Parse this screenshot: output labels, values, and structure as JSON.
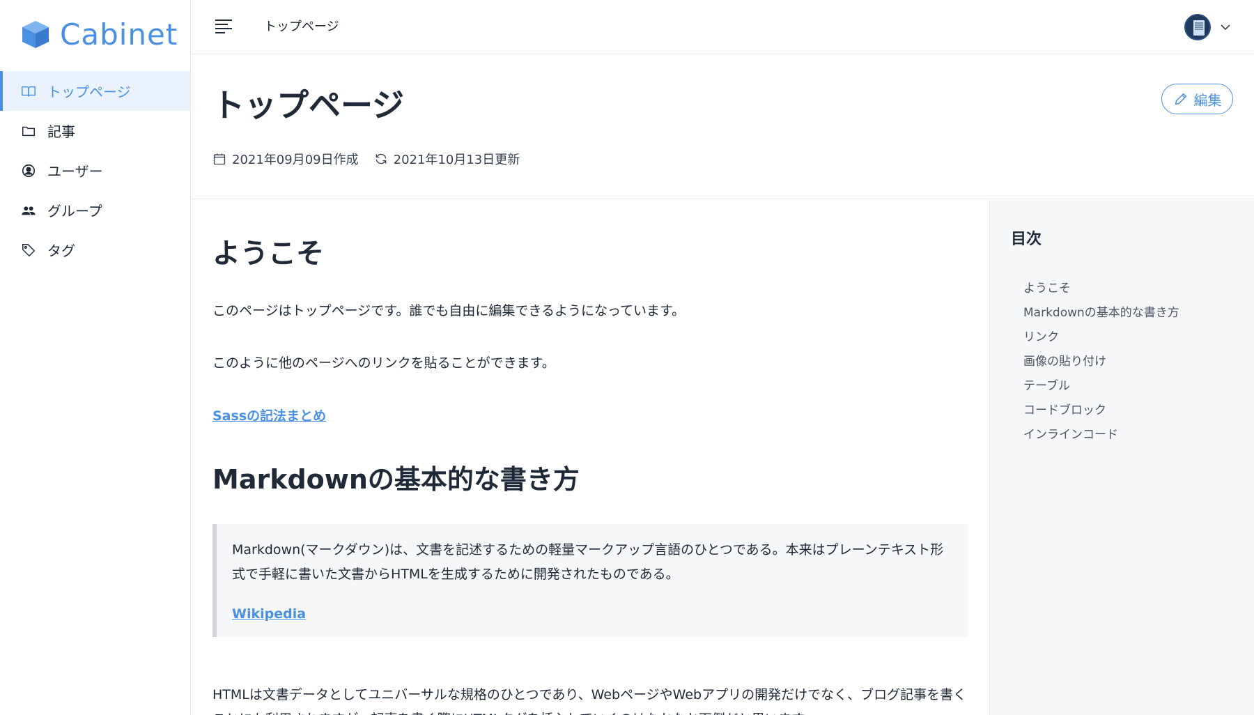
{
  "app": {
    "name": "Cabinet"
  },
  "sidebar": {
    "items": [
      {
        "label": "トップページ",
        "icon": "book-icon",
        "active": true
      },
      {
        "label": "記事",
        "icon": "folder-icon",
        "active": false
      },
      {
        "label": "ユーザー",
        "icon": "user-circle-icon",
        "active": false
      },
      {
        "label": "グループ",
        "icon": "users-icon",
        "active": false
      },
      {
        "label": "タグ",
        "icon": "tag-icon",
        "active": false
      }
    ]
  },
  "header": {
    "breadcrumb": "トップページ",
    "avatar_icon": "doc-avatar-icon"
  },
  "page": {
    "title": "トップページ",
    "edit_label": "編集",
    "created": "2021年09月09日作成",
    "updated": "2021年10月13日更新"
  },
  "content": {
    "h1": "ようこそ",
    "p1": "このページはトップページです。誰でも自由に編集できるようになっています。",
    "p2": "このように他のページへのリンクを貼ることができます。",
    "link1": "Sassの記法まとめ",
    "h2": "Markdownの基本的な書き方",
    "quote_text": "Markdown(マークダウン)は、文書を記述するための軽量マークアップ言語のひとつである。本来はプレーンテキスト形式で手軽に書いた文書からHTMLを生成するために開発されたものである。",
    "quote_link": "Wikipedia",
    "p3": "HTMLは文書データとしてユニバーサルな規格のひとつであり、WebページやWebアプリの開発だけでなく、ブログ記事を書くことにも利用されますが、記事を書く際にHTMLタグを挿入していくのはなかなか面倒だと思います。"
  },
  "toc": {
    "title": "目次",
    "items": [
      "ようこそ",
      "Markdownの基本的な書き方",
      "リンク",
      "画像の貼り付け",
      "テーブル",
      "コードブロック",
      "インラインコード"
    ]
  },
  "colors": {
    "accent": "#4a90e2",
    "active_bg": "#eaf3fd",
    "toc_bg": "#f6f7f8"
  }
}
